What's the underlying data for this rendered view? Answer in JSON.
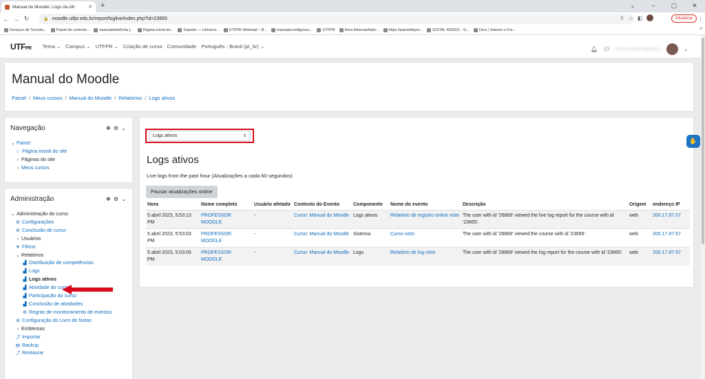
{
  "browser": {
    "tab_title": "Manual do Moodle: Logs da últi",
    "url": "moodle.utfpr.edu.br/report/loglive/index.php?id=23665",
    "update_label": "Atualizar",
    "bookmarks": [
      "Serviços de Tecnolo...",
      "Painel de controle...",
      "manuaistelefonia [...",
      "Página inicial do...",
      "Suporte — Universi...",
      "UTFPR Webmail :: B...",
      "manuaisconfiguracr...",
      "UTFPR",
      "Itens Almoxarifado...",
      "https://paineldepre...",
      "EDITAL 49/2021 - D...",
      "Dica | Vetores e Fot..."
    ]
  },
  "navbar": {
    "logo": "UTF",
    "logo_suffix": "PR",
    "menu": [
      "Tema ⌄",
      "Campus ⌄",
      "UTFPR ⌄",
      "Criação de curso",
      "Comunidade",
      "Português - Brasil (pt_br) ⌄"
    ],
    "user_name": "PROFESSOR MOODLE"
  },
  "header": {
    "title": "Manual do Moodle",
    "breadcrumb": [
      "Painel",
      "Meus cursos",
      "Manual do Moodle",
      "Relatórios",
      "Logs ativos"
    ]
  },
  "navigation_block": {
    "title": "Navegação",
    "items": [
      "Painel",
      "Página inicial do site",
      "Páginas do site",
      "Meus cursos"
    ]
  },
  "admin_block": {
    "title": "Administração",
    "items": [
      "Administração do curso",
      "Configurações",
      "Conclusão de curso",
      "Usuários",
      "Filtros",
      "Relatórios",
      "Distribuição de competências",
      "Logs",
      "Logs ativos",
      "Atividade do curso",
      "Participação do curso",
      "Conclusão de atividades",
      "Regras de monitoramento de eventos",
      "Configuração do Livro de Notas",
      "Emblemas",
      "Importar",
      "Backup",
      "Restaurar"
    ]
  },
  "main": {
    "select_value": "Logs ativos",
    "heading": "Logs ativos",
    "subtitle": "Live logs from the past hour (Atualizações a cada 60 segundos)",
    "pause_button": "Pausar atualizações online",
    "columns": [
      "Hora",
      "Nome completo",
      "Usuário afetado",
      "Contexto do Evento",
      "Componente",
      "Nome do evento",
      "Descrição",
      "Origem",
      "endereço IP"
    ],
    "rows": [
      [
        "5 abril 2023, 5:53:13 PM",
        "PROFESSOR MOODLE",
        "-",
        "Curso: Manual do Moodle",
        "Logs ativos",
        "Relatório de registro online visto",
        "The user with id '26889' viewed the live log report for the course with id '23665'.",
        "web",
        "200.17.97.57"
      ],
      [
        "5 abril 2023, 5:53:03 PM",
        "PROFESSOR MOODLE",
        "-",
        "Curso: Manual do Moodle",
        "Sistema",
        "Curso visto",
        "The user with id '26889' viewed the course with id '23665'.",
        "web",
        "200.17.97.57"
      ],
      [
        "5 abril 2023, 5:03:05 PM",
        "PROFESSOR MOODLE",
        "-",
        "Curso: Manual do Moodle",
        "Logs",
        "Relatório de log visto",
        "The user with id '26889' viewed the log report for the course with id '23665'.",
        "web",
        "200.17.97.57"
      ]
    ]
  },
  "colors": {
    "link": "#0f6cbf",
    "highlight": "#d8091b"
  }
}
